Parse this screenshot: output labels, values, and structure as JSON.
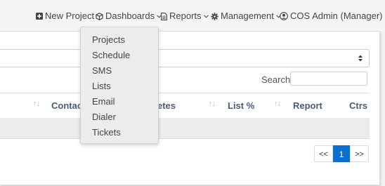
{
  "nav": {
    "new_project": "New Project",
    "dashboards": "Dashboards",
    "reports": "Reports",
    "management": "Management",
    "user": "COS Admin (Manager)"
  },
  "dashboards_menu": {
    "items": [
      "Projects",
      "Schedule",
      "SMS",
      "Lists",
      "Email",
      "Dialer",
      "Tickets"
    ]
  },
  "filters": {
    "search_label": "Search:",
    "search_value": ""
  },
  "table": {
    "columns": {
      "contacts": "Contacts",
      "completes": "etes",
      "list_pct": "List %",
      "report": "Report",
      "ctrs": "Ctrs"
    },
    "sort_glyph": "↑↓"
  },
  "pagination": {
    "prev": "<<",
    "current": "1",
    "next": ">>"
  },
  "colors": {
    "accent": "#0a6fd2",
    "header_text": "#4b5a75"
  }
}
